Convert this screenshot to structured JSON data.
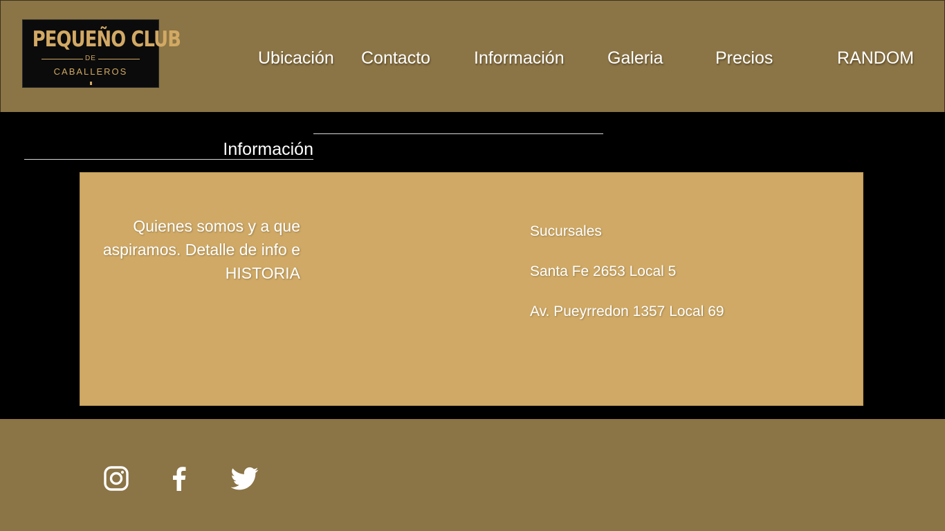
{
  "brand": {
    "logo_title": "PEQUEÑO CLUB",
    "logo_de": "DE",
    "logo_subtitle": "CABALLEROS"
  },
  "nav": {
    "items": [
      {
        "label": "Ubicación"
      },
      {
        "label": "Contacto"
      },
      {
        "label": "Información"
      },
      {
        "label": "Galeria"
      },
      {
        "label": "Precios"
      },
      {
        "label": "RANDOM"
      }
    ]
  },
  "section": {
    "title": "Información"
  },
  "content": {
    "about_text": "Quienes somos y a que aspiramos. Detalle de info e  HISTORIA",
    "branches_heading": "Sucursales",
    "branches": [
      "Santa Fe 2653 Local 5",
      "Av. Pueyrredon 1357 Local 69"
    ]
  },
  "footer": {
    "social": [
      {
        "icon": "instagram-icon"
      },
      {
        "icon": "facebook-icon"
      },
      {
        "icon": "twitter-icon"
      }
    ]
  },
  "colors": {
    "header_bg": "#8b7445",
    "card_bg": "#cfa965",
    "page_bg": "#000000",
    "logo_gold": "#d2a964",
    "text": "#ffffff"
  }
}
